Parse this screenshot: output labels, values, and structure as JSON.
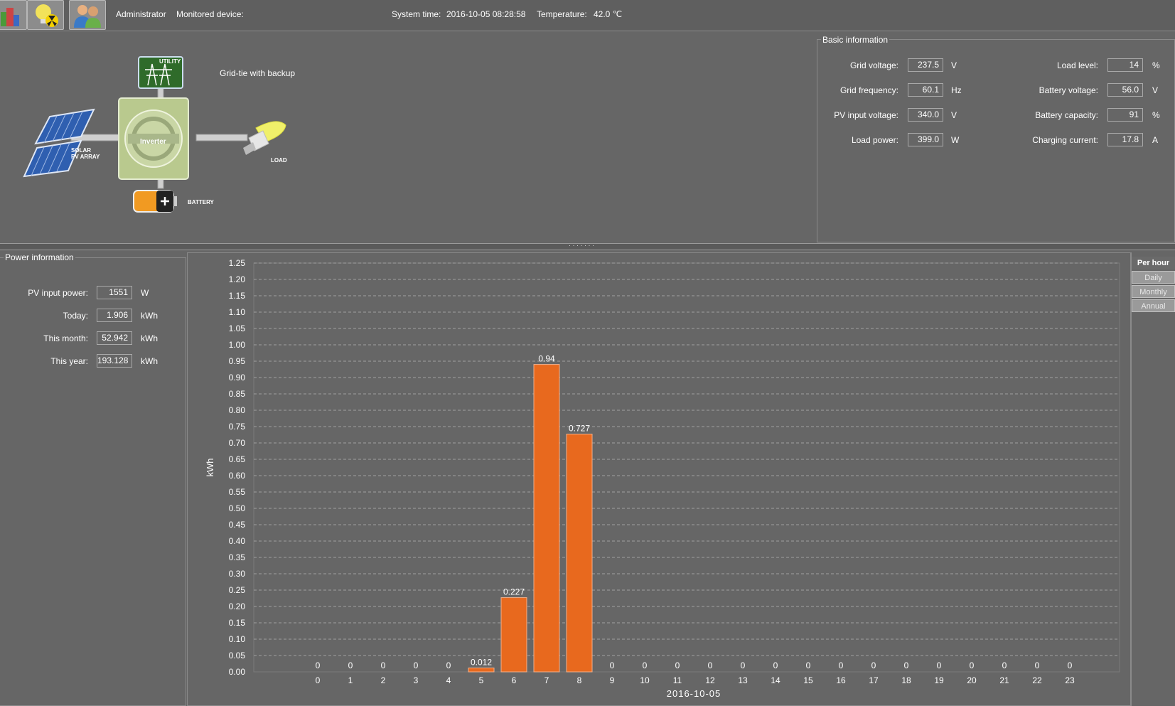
{
  "topbar": {
    "user": "Administrator",
    "monitored_device_label": "Monitored device:",
    "system_time_label": "System time:",
    "system_time": "2016-10-05 08:28:58",
    "temperature_label": "Temperature:",
    "temperature": "42.0 ℃"
  },
  "diagram": {
    "mode": "Grid-tie with backup",
    "utility_label": "UTILITY",
    "inverter_label": "Inverter",
    "solar_label_1": "SOLAR",
    "solar_label_2": "PV ARRAY",
    "load_label": "LOAD",
    "battery_label": "BATTERY"
  },
  "basic": {
    "title": "Basic information",
    "grid_voltage": {
      "label": "Grid voltage:",
      "value": "237.5",
      "unit": "V"
    },
    "grid_frequency": {
      "label": "Grid frequency:",
      "value": "60.1",
      "unit": "Hz"
    },
    "pv_input_voltage": {
      "label": "PV input voltage:",
      "value": "340.0",
      "unit": "V"
    },
    "load_power": {
      "label": "Load power:",
      "value": "399.0",
      "unit": "W"
    },
    "load_level": {
      "label": "Load level:",
      "value": "14",
      "unit": "%"
    },
    "battery_voltage": {
      "label": "Battery voltage:",
      "value": "56.0",
      "unit": "V"
    },
    "battery_capacity": {
      "label": "Battery capacity:",
      "value": "91",
      "unit": "%"
    },
    "charging_current": {
      "label": "Charging current:",
      "value": "17.8",
      "unit": "A"
    }
  },
  "power": {
    "title": "Power information",
    "pv_input_power": {
      "label": "PV input power:",
      "value": "1551",
      "unit": "W"
    },
    "today": {
      "label": "Today:",
      "value": "1.906",
      "unit": "kWh"
    },
    "this_month": {
      "label": "This month:",
      "value": "52.942",
      "unit": "kWh"
    },
    "this_year": {
      "label": "This year:",
      "value": "193.128",
      "unit": "kWh"
    }
  },
  "tabs": {
    "per_hour": "Per hour",
    "daily": "Daily",
    "monthly": "Monthly",
    "annual": "Annual"
  },
  "splitter_dots": "· · · · · · ·",
  "colors": {
    "bar": "#e8691e",
    "background": "#666666",
    "grid": "#a0a0a0"
  },
  "chart_data": {
    "type": "bar",
    "categories": [
      "0",
      "1",
      "2",
      "3",
      "4",
      "5",
      "6",
      "7",
      "8",
      "9",
      "10",
      "11",
      "12",
      "13",
      "14",
      "15",
      "16",
      "17",
      "18",
      "19",
      "20",
      "21",
      "22",
      "23"
    ],
    "values": [
      0,
      0,
      0,
      0,
      0,
      0.012,
      0.227,
      0.94,
      0.727,
      0,
      0,
      0,
      0,
      0,
      0,
      0,
      0,
      0,
      0,
      0,
      0,
      0,
      0,
      0
    ],
    "data_labels": [
      "0",
      "0",
      "0",
      "0",
      "0",
      "0.012",
      "0.227",
      "0.94",
      "0.727",
      "0",
      "0",
      "0",
      "0",
      "0",
      "0",
      "0",
      "0",
      "0",
      "0",
      "0",
      "0",
      "0",
      "0",
      "0"
    ],
    "xlabel": "2016-10-05",
    "ylabel": "kWh",
    "ylim": [
      0,
      1.25
    ],
    "ytick_step": 0.05,
    "grid": true
  }
}
